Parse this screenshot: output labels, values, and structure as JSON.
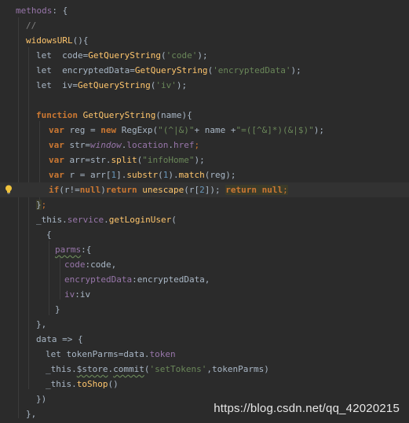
{
  "code": {
    "l1_methods": "methods",
    "l1_rest": ": {",
    "l2_comment": "//",
    "l3_name": "widowsURL",
    "l3_rest": "(){",
    "l4_let": "let",
    "l4_var": "code=",
    "l4_fn": "GetQueryString",
    "l4_paren": "(",
    "l4_str": "'code'",
    "l4_end": ");",
    "l5_let": "let",
    "l5_var": "encryptedData=",
    "l5_fn": "GetQueryString",
    "l5_paren": "(",
    "l5_str": "'encryptedData'",
    "l5_end": ");",
    "l6_let": "let",
    "l6_var": "iv=",
    "l6_fn": "GetQueryString",
    "l6_paren": "(",
    "l6_str": "'iv'",
    "l6_end": ");",
    "l8_kw": "function",
    "l8_fn": "GetQueryString",
    "l8_rest": "(name){",
    "l9_kw": "var",
    "l9_a": "reg = ",
    "l9_new": "new",
    "l9_b": "RegExp(",
    "l9_s1": "\"(^|&)\"",
    "l9_c": "+ name +",
    "l9_s2": "\"=([^&]*)(&|$)\"",
    "l9_end": ");",
    "l10_kw": "var",
    "l10_a": "str=",
    "l10_win": "window",
    "l10_b": ".",
    "l10_loc": "location",
    "l10_c": ".",
    "l10_href": "href",
    "l10_end": ";",
    "l11_kw": "var",
    "l11_a": "arr=str.",
    "l11_fn": "split",
    "l11_p": "(",
    "l11_str": "\"infoHome\"",
    "l11_end": ");",
    "l12_kw": "var",
    "l12_a": "r = arr[",
    "l12_n1": "1",
    "l12_b": "].",
    "l12_fn": "substr",
    "l12_c": "(",
    "l12_n2": "1",
    "l12_d": ").",
    "l12_fn2": "match",
    "l12_end": "(reg);",
    "l13_if": "if",
    "l13_a": "(r!=",
    "l13_null": "null",
    "l13_b": ")",
    "l13_ret": "return",
    "l13_fn": "unescape",
    "l13_c": "(r[",
    "l13_n": "2",
    "l13_d": "]);",
    "l13_ret2": "return",
    "l13_null2": "null",
    "l13_semi": ";",
    "l14": "}",
    "l14_semi": ";",
    "l15_this": "_this.",
    "l15_svc": "service",
    "l15_dot": ".",
    "l15_fn": "getLoginUser",
    "l15_p": "(",
    "l16": "{",
    "l17_key": "parms",
    "l17_rest": ":{",
    "l18_key": "code",
    "l18_rest": ":code,",
    "l19_key": "encryptedData",
    "l19_rest": ":encryptedData,",
    "l20_key": "iv",
    "l20_rest": ":iv",
    "l21": "}",
    "l22": "},",
    "l23": "data => {",
    "l24_let": "let",
    "l24_a": "tokenParms=data.",
    "l24_tok": "token",
    "l25_a": "_this.",
    "l25_store": "$store",
    "l25_b": ".",
    "l25_commit": "commit",
    "l25_c": "(",
    "l25_str": "'setTokens'",
    "l25_d": ",tokenParms)",
    "l26_a": "_this.",
    "l26_fn": "toShop",
    "l26_b": "()",
    "l27": "})",
    "l28": "},"
  },
  "watermark": "https://blog.csdn.net/qq_42020215",
  "icons": {
    "intention": "lightbulb-icon"
  },
  "colors": {
    "background": "#2b2b2b",
    "keyword": "#cc7832",
    "function": "#ffc66d",
    "string": "#6a8759",
    "property": "#9876aa",
    "text": "#a9b7c6",
    "comment": "#808080"
  }
}
